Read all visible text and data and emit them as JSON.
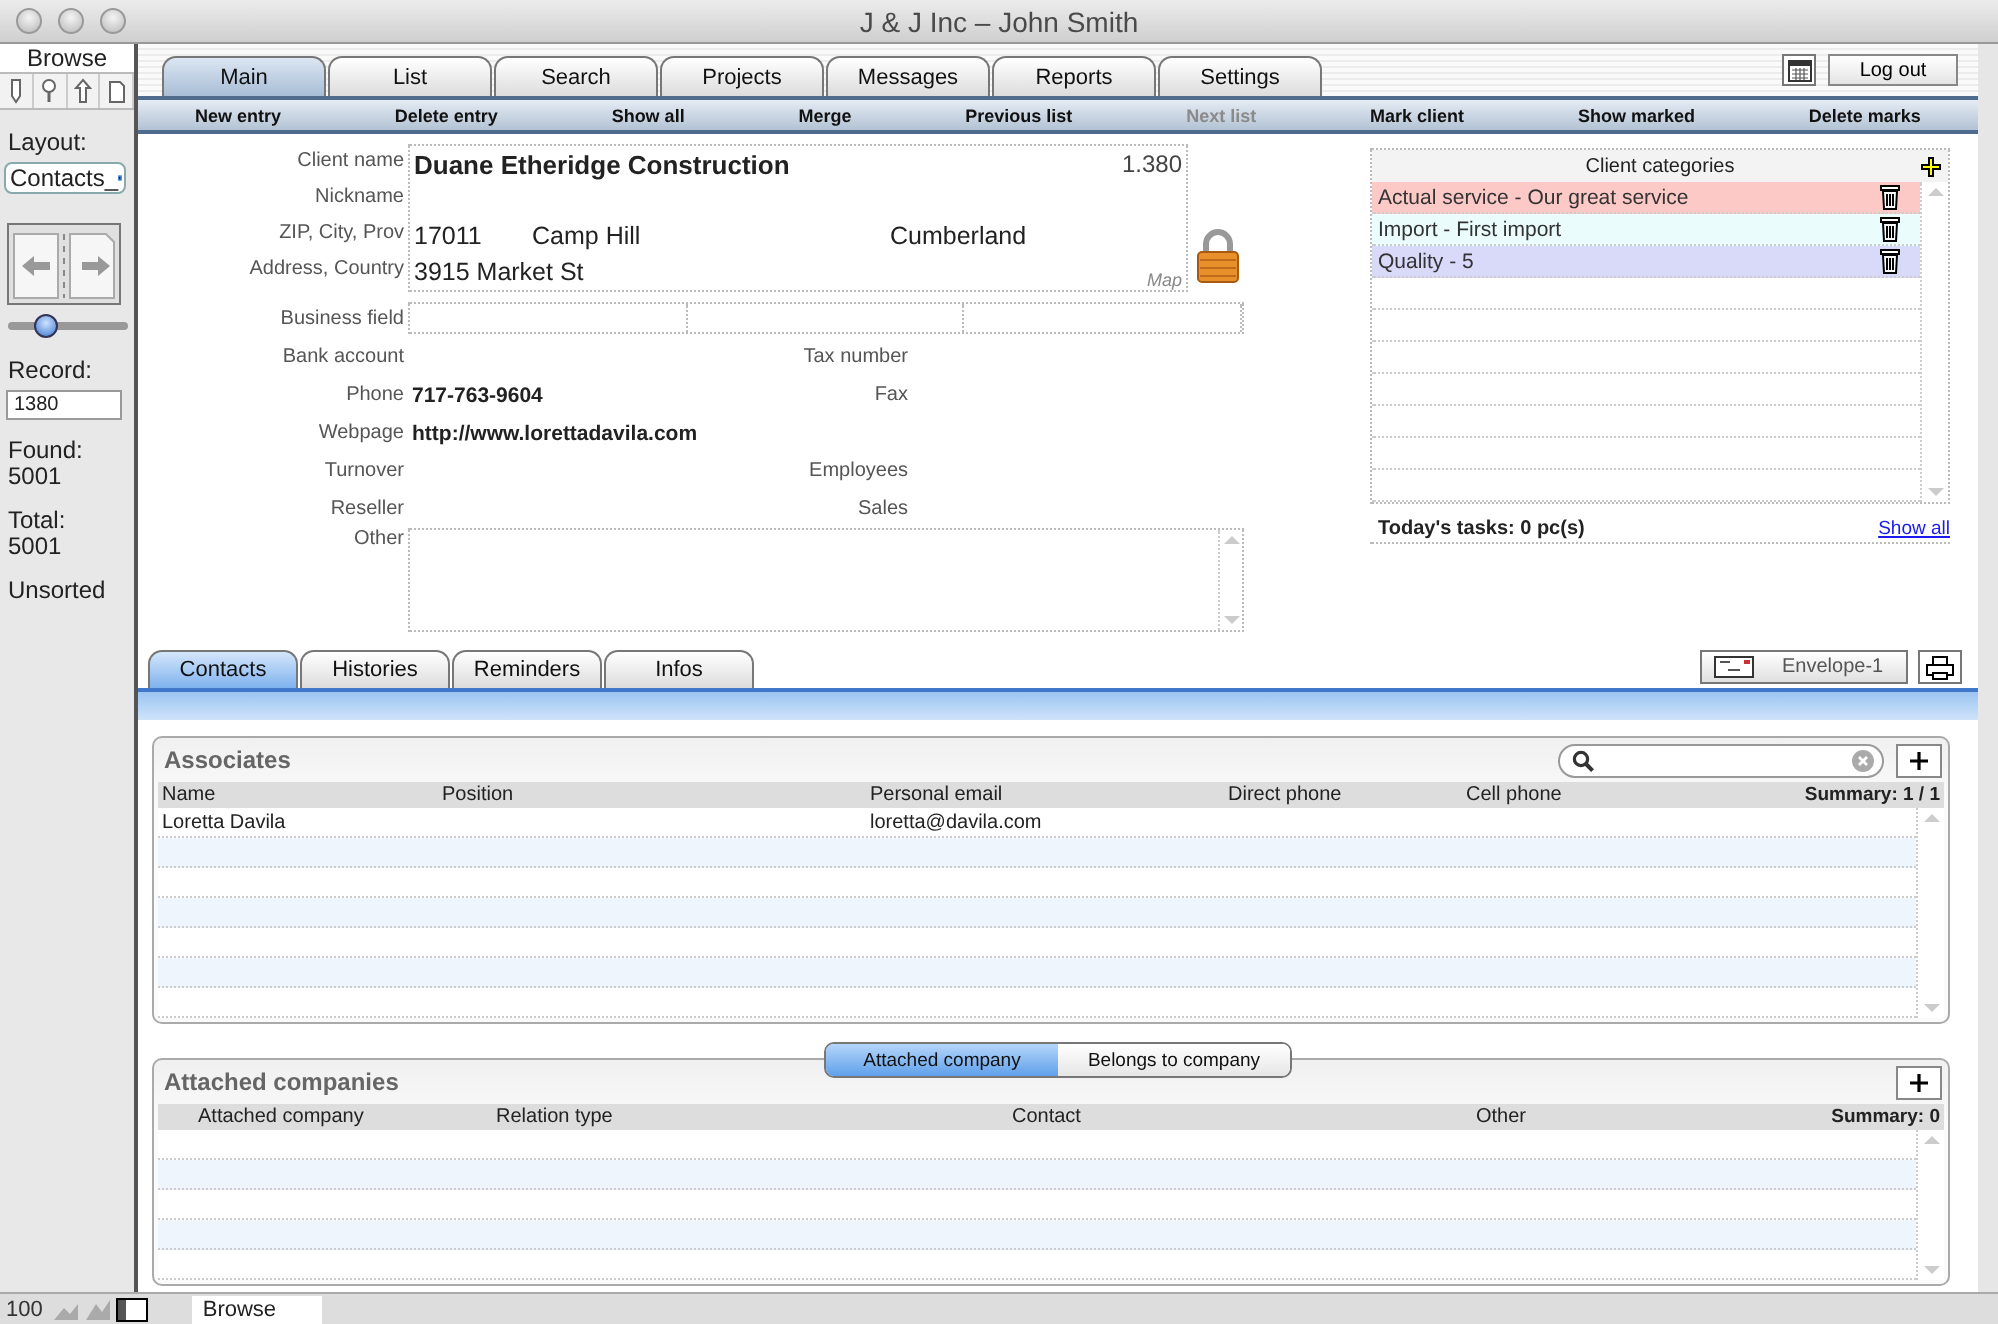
{
  "window": {
    "title": "J & J  Inc – John Smith"
  },
  "status_area": {
    "mode": "Browse",
    "tools": [
      {
        "kind": "pen"
      },
      {
        "kind": "magnifier"
      },
      {
        "kind": "arrow"
      },
      {
        "kind": "page"
      }
    ],
    "layout_label": "Layout:",
    "layout_value": "Contacts_",
    "slider": {
      "level": 0.28
    },
    "record_label": "Record:",
    "record_value": "1380",
    "found_label": "Found:",
    "found_value": "5001",
    "total_label": "Total:",
    "total_value": "5001",
    "sort_state": "Unsorted"
  },
  "tabs": [
    {
      "label": "Main",
      "selected": true
    },
    {
      "label": "List",
      "selected": false
    },
    {
      "label": "Search",
      "selected": false
    },
    {
      "label": "Projects",
      "selected": false
    },
    {
      "label": "Messages",
      "selected": false
    },
    {
      "label": "Reports",
      "selected": false
    },
    {
      "label": "Settings",
      "selected": false
    }
  ],
  "logout_button": "Log out",
  "actions": [
    {
      "label": "New entry",
      "disabled": false
    },
    {
      "label": "Delete entry",
      "disabled": false
    },
    {
      "label": "Show all",
      "disabled": false
    },
    {
      "label": "Merge",
      "disabled": false
    },
    {
      "label": "Previous list",
      "disabled": false
    },
    {
      "label": "Next list",
      "disabled": true
    },
    {
      "label": "Mark client",
      "disabled": false
    },
    {
      "label": "Show marked",
      "disabled": false
    },
    {
      "label": "Delete marks",
      "disabled": false
    }
  ],
  "client": {
    "name_label": "Client name",
    "name": "Duane Etheridge Construction",
    "record_number": "1.380",
    "nickname_label": "Nickname",
    "zip_label": "ZIP, City, Prov",
    "zip": "17011",
    "city": "Camp Hill",
    "province": "Cumberland",
    "address_label": "Address, Country",
    "address": "3915 Market St",
    "map_link": "Map",
    "business_field_label": "Business field"
  },
  "details": [
    {
      "left_label": "Bank account",
      "right_label": "Tax number"
    },
    {
      "left_label": "Phone",
      "left_value": "717-763-9604",
      "right_label": "Fax"
    },
    {
      "left_label": "Webpage",
      "left_value": "http://www.lorettadavila.com"
    },
    {
      "left_label": "Turnover",
      "right_label": "Employees"
    },
    {
      "left_label": "Reseller",
      "right_label": "Sales"
    }
  ],
  "other_label": "Other",
  "client_categories": {
    "title": "Client categories",
    "items": [
      {
        "label": "Actual service - Our great service",
        "color": "#fdc9c7"
      },
      {
        "label": "Import - First import",
        "color": "#eafcfc"
      },
      {
        "label": "Quality - 5",
        "color": "#d9dafa"
      }
    ]
  },
  "tasks": {
    "text": "Today's tasks: 0 pc(s)",
    "link": "Show all"
  },
  "subtabs": [
    {
      "label": "Contacts",
      "selected": true
    },
    {
      "label": "Histories",
      "selected": false
    },
    {
      "label": "Reminders",
      "selected": false
    },
    {
      "label": "Infos",
      "selected": false
    }
  ],
  "envelope_button": "Envelope-1",
  "associates": {
    "title": "Associates",
    "columns": [
      "Name",
      "Position",
      "Personal email",
      "Direct phone",
      "Cell phone"
    ],
    "summary": "Summary: 1 / 1",
    "rows": [
      {
        "cells": [
          "Loretta Davila",
          null,
          "loretta@davila.com",
          null,
          null
        ]
      }
    ]
  },
  "relation_switch": [
    {
      "label": "Attached company",
      "selected": true
    },
    {
      "label": "Belongs to company",
      "selected": false
    }
  ],
  "attached_companies": {
    "title": "Attached companies",
    "columns": [
      "Attached company",
      "Relation type",
      "Contact",
      "Other"
    ],
    "summary": "Summary: 0"
  },
  "bottom_bar": {
    "zoom": "100",
    "mode": "Browse"
  }
}
